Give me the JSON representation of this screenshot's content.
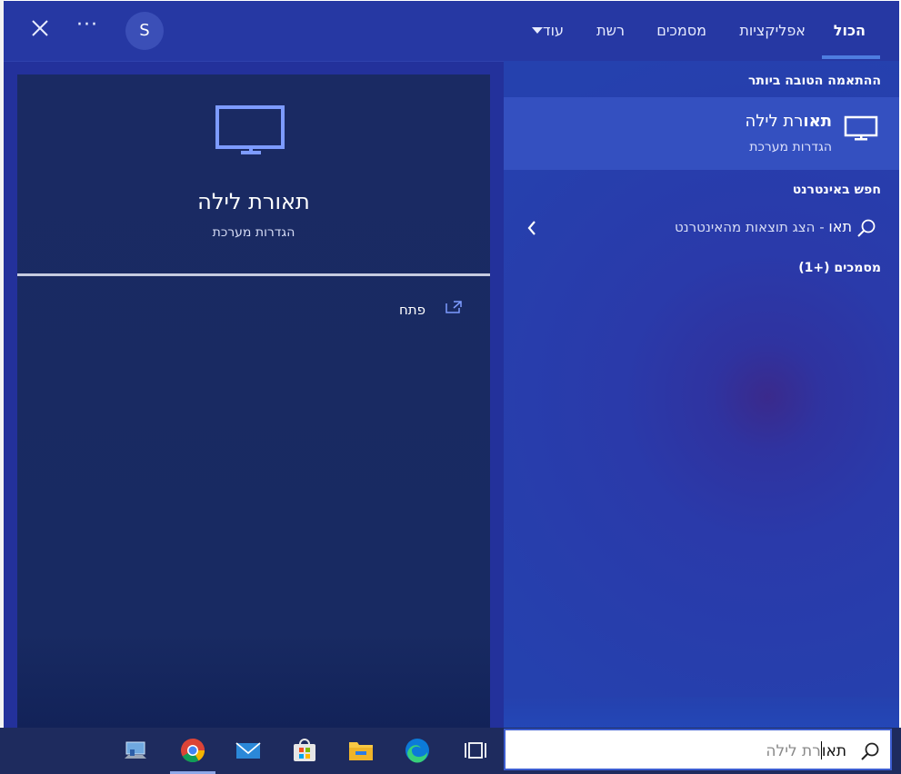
{
  "tabs": [
    {
      "label": "הכול",
      "active": true
    },
    {
      "label": "אפליקציות",
      "active": false
    },
    {
      "label": "מסמכים",
      "active": false
    },
    {
      "label": "רשת",
      "active": false
    },
    {
      "label": "עוד",
      "active": false
    }
  ],
  "header": {
    "avatar_letter": "S",
    "more_label": "···"
  },
  "preview": {
    "icon": "monitor-icon",
    "title": "תאורת לילה",
    "subtitle": "הגדרות מערכת",
    "open_label": "פתח",
    "open_icon": "open-external-icon"
  },
  "results": {
    "best_match_heading": "ההתאמה הטובה ביותר",
    "best_match": {
      "icon": "monitor-icon",
      "title_bold": "תאו",
      "title_rest": "רת לילה",
      "subtitle": "הגדרות מערכת"
    },
    "web_heading": "חפש באינטרנט",
    "web_query": "תאו",
    "web_suffix": " - הצג תוצאות מהאינטרנט",
    "documents_heading": "מסמכים (+1)"
  },
  "search": {
    "typed": "תאו",
    "completion": "רת לילה",
    "icon": "search-icon"
  },
  "taskbar": {
    "icons": [
      "network-computer-icon",
      "chrome-icon",
      "mail-icon",
      "store-icon",
      "file-explorer-icon",
      "edge-icon",
      "task-view-icon"
    ]
  },
  "colors": {
    "panel_bg": "#23319b",
    "preview_bg": "#1a2a63",
    "best_match_bg": "#3450c0",
    "accent": "#4e7de0",
    "taskbar_bg": "#1e2b5e"
  }
}
